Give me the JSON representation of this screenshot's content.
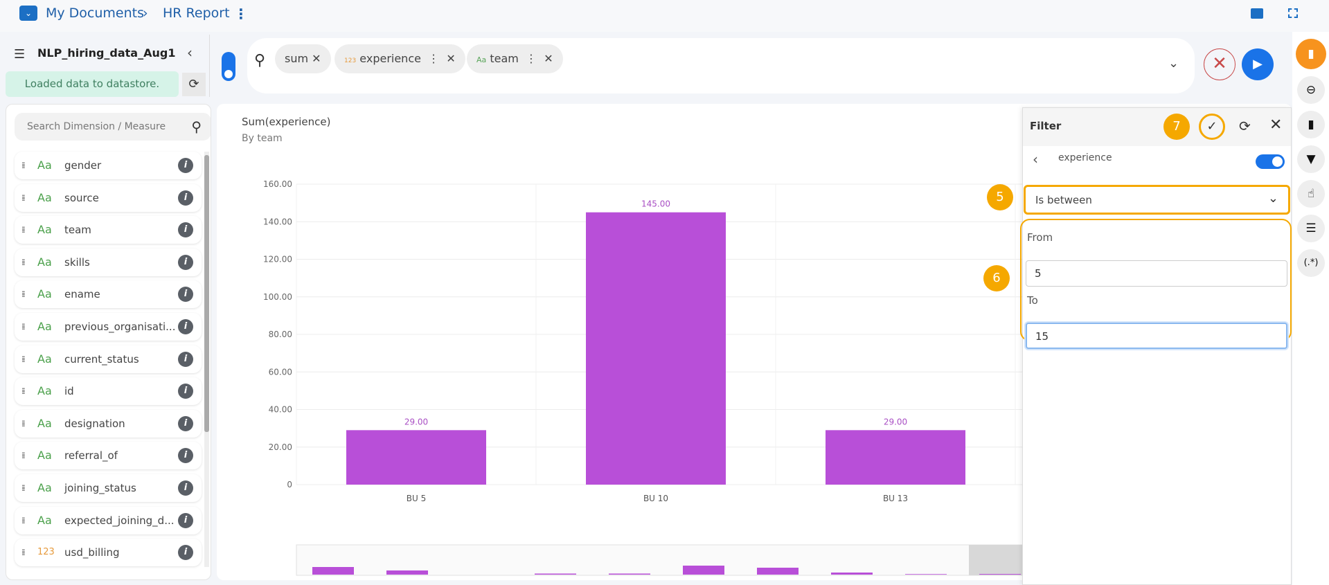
{
  "header": {
    "breadcrumb": [
      "My Documents",
      "HR Report"
    ],
    "separator": "›"
  },
  "dataset": {
    "name": "NLP_hiring_data_Aug1",
    "status": "Loaded data to datastore."
  },
  "query": {
    "chips": [
      {
        "type": "",
        "label": "sum"
      },
      {
        "type": "123",
        "label": "experience"
      },
      {
        "type": "Aa",
        "label": "team"
      }
    ]
  },
  "sidebar": {
    "search_placeholder": "Search Dimension / Measure",
    "items": [
      {
        "type": "Aa",
        "label": "gender"
      },
      {
        "type": "Aa",
        "label": "source"
      },
      {
        "type": "Aa",
        "label": "team"
      },
      {
        "type": "Aa",
        "label": "skills"
      },
      {
        "type": "Aa",
        "label": "ename"
      },
      {
        "type": "Aa",
        "label": "previous_organisati..."
      },
      {
        "type": "Aa",
        "label": "current_status"
      },
      {
        "type": "Aa",
        "label": "id"
      },
      {
        "type": "Aa",
        "label": "designation"
      },
      {
        "type": "Aa",
        "label": "referral_of"
      },
      {
        "type": "Aa",
        "label": "joining_status"
      },
      {
        "type": "Aa",
        "label": "expected_joining_d..."
      },
      {
        "type": "123",
        "label": "usd_billing"
      }
    ]
  },
  "chart_data": {
    "type": "bar",
    "title": "Sum(experience)",
    "subtitle": "By team",
    "categories": [
      "BU 5",
      "BU 10",
      "BU 13"
    ],
    "values": [
      29,
      145,
      29
    ],
    "value_labels": [
      "29.00",
      "145.00",
      "29.00"
    ],
    "yticks": [
      "0",
      "20.00",
      "40.00",
      "60.00",
      "80.00",
      "100.00",
      "120.00",
      "140.00",
      "160.00"
    ],
    "ylim": [
      0,
      160
    ],
    "color": "#b84fd8"
  },
  "filter": {
    "title": "Filter",
    "field": "experience",
    "enabled": true,
    "operator": "Is between",
    "from_label": "From",
    "from_value": "5",
    "to_label": "To",
    "to_value": "15",
    "callouts": [
      "5",
      "6",
      "7"
    ]
  },
  "rail": {
    "icons": [
      "sd-card-icon",
      "back-arrow-icon",
      "bar-chart-icon",
      "filter-icon",
      "pointer-icon",
      "database-icon",
      "regex-icon"
    ],
    "regex_label": "(.*)"
  }
}
